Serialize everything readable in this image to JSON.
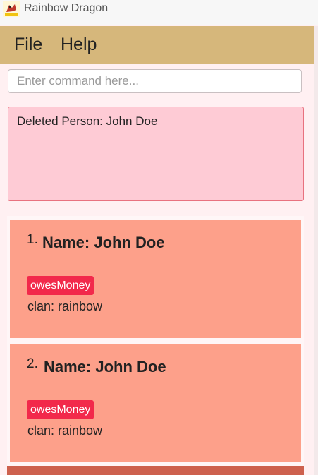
{
  "window": {
    "title": "Rainbow Dragon",
    "icon": "rainbow-dragon-logo-icon"
  },
  "menu": {
    "items": [
      {
        "label": "File"
      },
      {
        "label": "Help"
      }
    ]
  },
  "command": {
    "placeholder": "Enter command here...",
    "value": ""
  },
  "result": {
    "message": "Deleted Person: John Doe"
  },
  "persons": [
    {
      "index": "1.",
      "name": "Name: John Doe",
      "tags": [
        "owesMoney"
      ],
      "clan": "clan: rainbow"
    },
    {
      "index": "2.",
      "name": "Name: John Doe",
      "tags": [
        "owesMoney"
      ],
      "clan": "clan: rainbow"
    }
  ],
  "colors": {
    "menubar": "#d6b77b",
    "card": "#fda08a",
    "tag": "#f2294b",
    "result_bg": "#fecbd5",
    "result_border": "#e8727f",
    "card_partial": "#cd614e"
  }
}
